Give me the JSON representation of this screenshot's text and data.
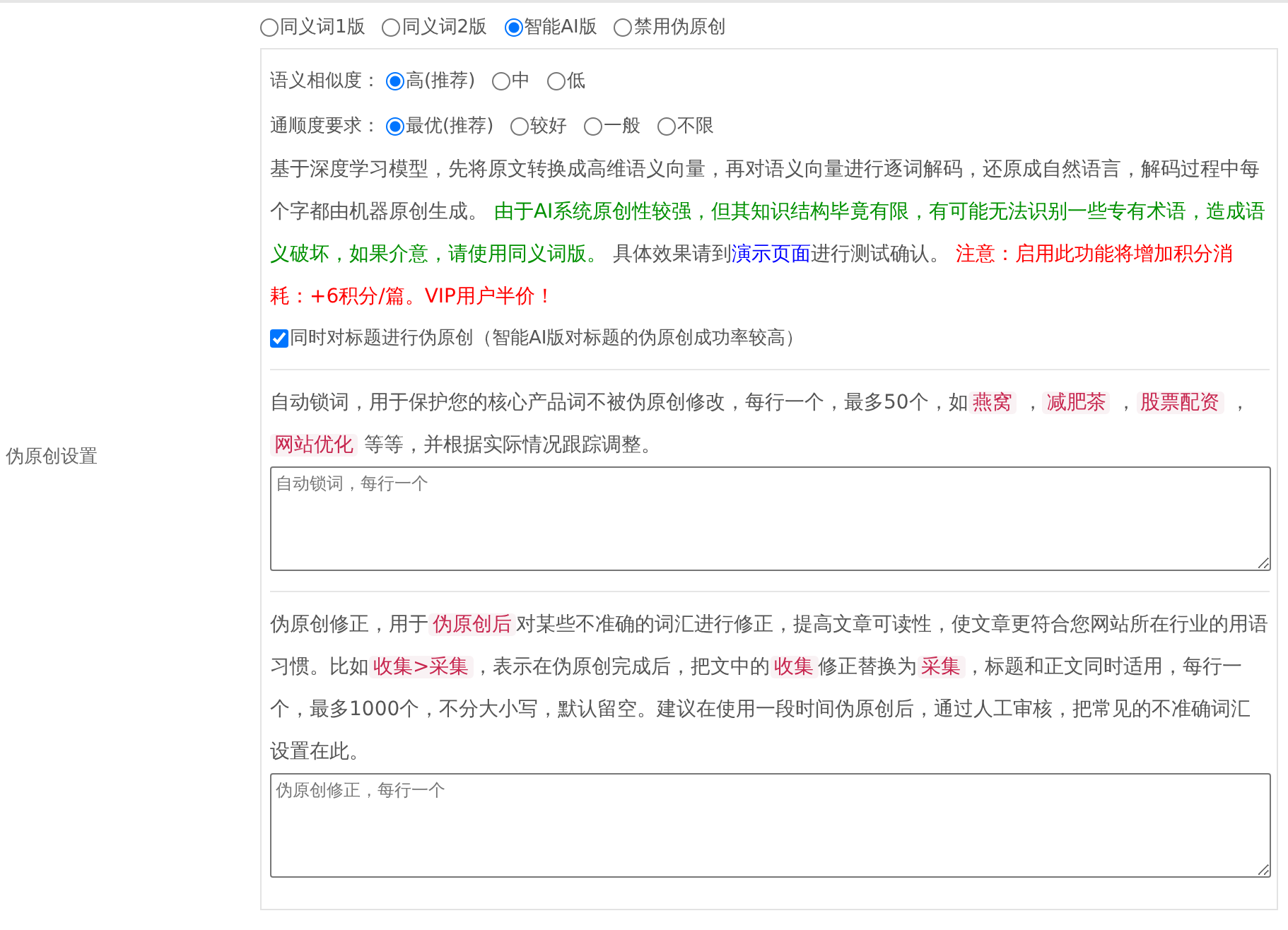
{
  "section_label": "伪原创设置",
  "versions": [
    {
      "label": "同义词1版",
      "selected": false
    },
    {
      "label": "同义词2版",
      "selected": false
    },
    {
      "label": "智能AI版",
      "selected": true
    },
    {
      "label": "禁用伪原创",
      "selected": false
    }
  ],
  "settings": [
    {
      "label": "语义相似度：",
      "options": [
        {
          "label": "高(推荐)",
          "selected": true
        },
        {
          "label": "中",
          "selected": false
        },
        {
          "label": "低",
          "selected": false
        }
      ]
    },
    {
      "label": "通顺度要求：",
      "options": [
        {
          "label": "最优(推荐)",
          "selected": true
        },
        {
          "label": "较好",
          "selected": false
        },
        {
          "label": "一般",
          "selected": false
        },
        {
          "label": "不限",
          "selected": false
        }
      ]
    }
  ],
  "ai_description": [
    {
      "kind": "plain",
      "text": "基于深度学习模型，先将原文转换成高维语义向量，再对语义向量进行逐词解码，还原成自然语言，解码过程中每个字都由机器原创生成。 "
    },
    {
      "kind": "note",
      "text": "由于AI系统原创性较强，但其知识结构毕竟有限，有可能无法识别一些专有术语，造成语义破坏，如果介意，请使用同义词版。"
    },
    {
      "kind": "plain",
      "text": " 具体效果请到"
    },
    {
      "kind": "link",
      "text": "演示页面"
    },
    {
      "kind": "plain",
      "text": "进行测试确认。 "
    },
    {
      "kind": "warning",
      "text": "注意：启用此功能将增加积分消耗：+6积分/篇。VIP用户半价！"
    }
  ],
  "title_option": {
    "label": "同时对标题进行伪原创（智能AI版对标题的伪原创成功率较高）",
    "checked": true
  },
  "lock_words": {
    "description": [
      {
        "kind": "plain",
        "text": "自动锁词，用于保护您的核心产品词不被伪原创修改，每行一个，最多50个，如"
      },
      {
        "kind": "code",
        "text": "燕窝"
      },
      {
        "kind": "plain",
        "text": " ，"
      },
      {
        "kind": "code",
        "text": "减肥茶"
      },
      {
        "kind": "plain",
        "text": " ，"
      },
      {
        "kind": "code",
        "text": "股票配资"
      },
      {
        "kind": "plain",
        "text": " ，"
      },
      {
        "kind": "code",
        "text": "网站优化"
      },
      {
        "kind": "plain",
        "text": " 等等，并根据实际情况跟踪调整。"
      }
    ],
    "placeholder": "自动锁词，每行一个"
  },
  "corrections": {
    "description": [
      {
        "kind": "plain",
        "text": "伪原创修正，用于"
      },
      {
        "kind": "code",
        "text": "伪原创后"
      },
      {
        "kind": "plain",
        "text": "对某些不准确的词汇进行修正，提高文章可读性，使文章更符合您网站所在行业的用语习惯。比如"
      },
      {
        "kind": "code",
        "text": "收集>采集"
      },
      {
        "kind": "plain",
        "text": "，表示在伪原创完成后，把文中的"
      },
      {
        "kind": "code",
        "text": "收集"
      },
      {
        "kind": "plain",
        "text": "修正替换为"
      },
      {
        "kind": "code",
        "text": "采集"
      },
      {
        "kind": "plain",
        "text": "，标题和正文同时适用，每行一个，最多1000个，不分大小写，默认留空。建议在使用一段时间伪原创后，通过人工审核，把常见的不准确词汇设置在此。"
      }
    ],
    "placeholder": "伪原创修正，每行一个"
  }
}
